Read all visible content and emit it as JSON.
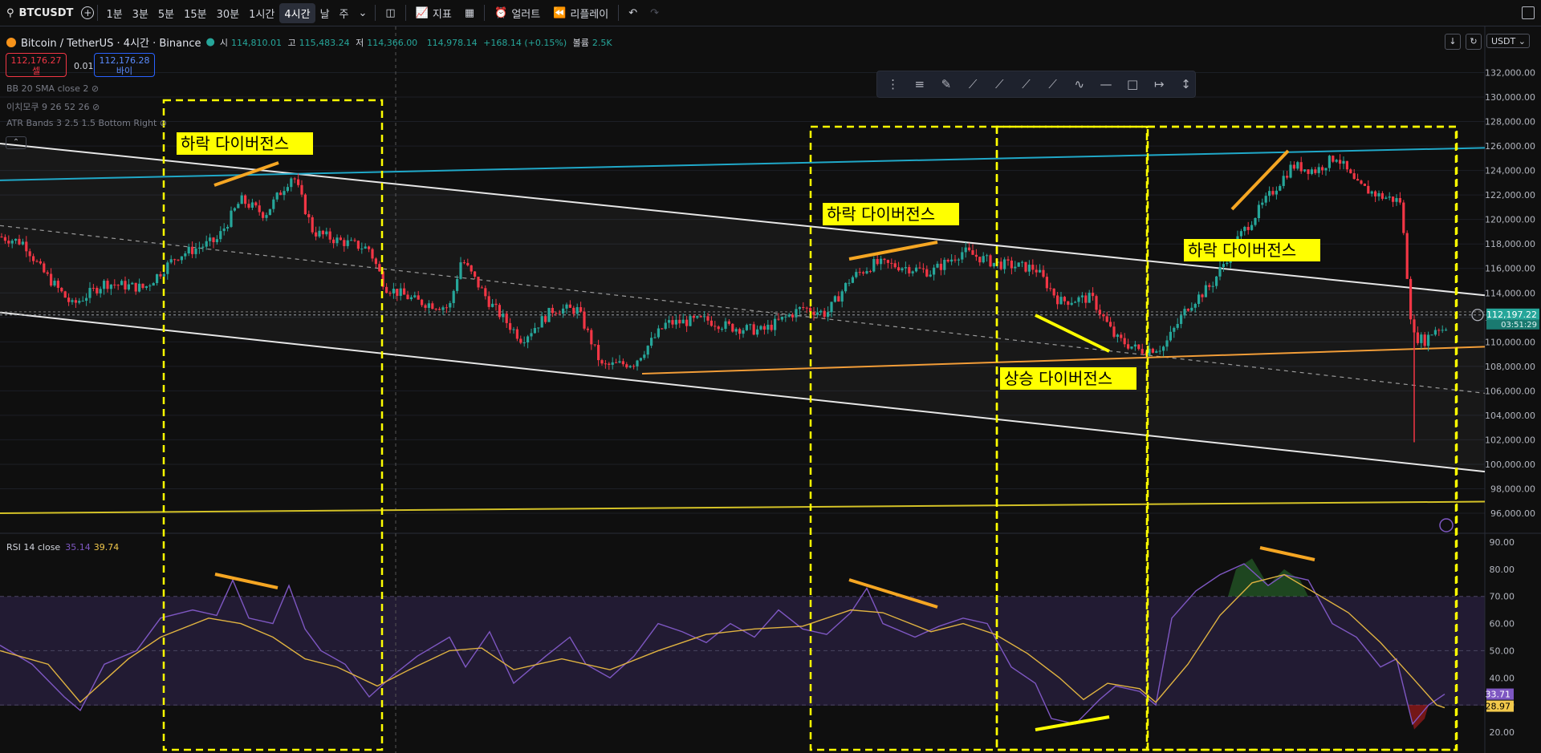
{
  "toolbar": {
    "symbol": "BTCUSDT",
    "timeframes": [
      "1분",
      "3분",
      "5분",
      "15분",
      "30분",
      "1시간",
      "4시간",
      "날",
      "주"
    ],
    "active_timeframe": "4시간",
    "indicators_label": "지표",
    "alerts_label": "얼러트",
    "replay_label": "리플레이"
  },
  "legend": {
    "title": "Bitcoin / TetherUS · 4시간 · Binance",
    "open_label": "시",
    "open": "114,810.01",
    "high_label": "고",
    "high": "115,483.24",
    "low_label": "저",
    "low": "114,366.00",
    "close_label": "",
    "close": "114,978.14",
    "change": "+168.14 (+0.15%)",
    "volume_label": "볼륨",
    "volume": "2.5K",
    "sell_price": "112,176.27",
    "sell_label": "셀",
    "spread": "0.01",
    "buy_price": "112,176.28",
    "buy_label": "바이",
    "indicators": [
      "BB 20 SMA close 2",
      "이치모쿠 9 26 52 26",
      "ATR Bands 3 2.5 1.5 Bottom Right"
    ],
    "rsi_label": "RSI 14 close",
    "rsi_value": "35.14",
    "rsi_ma_value": "39.74"
  },
  "currency": "USDT",
  "colors": {
    "up": "#26a69a",
    "down": "#f23645",
    "annotation_box": "#ffff00",
    "annotation_line": "#f5a623",
    "channel": "#e6e6e6",
    "cyan_line": "#20a8c8",
    "support": "#f29d38",
    "yellow_line": "#d4c227",
    "rsi": "#7e57c2",
    "rsi_ma": "#e0b341"
  },
  "chart_data": [
    {
      "type": "candlestick",
      "title": "Bitcoin / TetherUS · 4시간 · Binance",
      "y_ticks": [
        "132,000.00",
        "130,000.00",
        "128,000.00",
        "126,000.00",
        "124,000.00",
        "122,000.00",
        "120,000.00",
        "118,000.00",
        "116,000.00",
        "114,000.00",
        "112,000.00",
        "110,000.00",
        "108,000.00",
        "106,000.00",
        "104,000.00",
        "102,000.00",
        "100,000.00",
        "98,000.00",
        "96,000.00"
      ],
      "ylim": [
        95500,
        132800
      ],
      "last_price": "112,197.22",
      "countdown": "03:51:29",
      "path": [
        [
          0,
          118600
        ],
        [
          30,
          118100
        ],
        [
          50,
          116000
        ],
        [
          90,
          113000
        ],
        [
          130,
          114800
        ],
        [
          180,
          114400
        ],
        [
          220,
          117000
        ],
        [
          270,
          118300
        ],
        [
          300,
          121600
        ],
        [
          330,
          120400
        ],
        [
          365,
          123700
        ],
        [
          390,
          119000
        ],
        [
          420,
          118300
        ],
        [
          460,
          117600
        ],
        [
          480,
          114500
        ],
        [
          520,
          113300
        ],
        [
          560,
          112800
        ],
        [
          575,
          116800
        ],
        [
          610,
          113200
        ],
        [
          650,
          110200
        ],
        [
          690,
          112700
        ],
        [
          720,
          112600
        ],
        [
          750,
          108000
        ],
        [
          790,
          108300
        ],
        [
          830,
          111500
        ],
        [
          880,
          111800
        ],
        [
          910,
          111200
        ],
        [
          950,
          110900
        ],
        [
          1000,
          112800
        ],
        [
          1030,
          112300
        ],
        [
          1060,
          115200
        ],
        [
          1090,
          116400
        ],
        [
          1120,
          116200
        ],
        [
          1160,
          115700
        ],
        [
          1200,
          117400
        ],
        [
          1240,
          116400
        ],
        [
          1290,
          116000
        ],
        [
          1320,
          113300
        ],
        [
          1360,
          113600
        ],
        [
          1390,
          110300
        ],
        [
          1420,
          109300
        ],
        [
          1450,
          109600
        ],
        [
          1480,
          112900
        ],
        [
          1510,
          114700
        ],
        [
          1540,
          118200
        ],
        [
          1580,
          121800
        ],
        [
          1610,
          124400
        ],
        [
          1640,
          124000
        ],
        [
          1665,
          125200
        ],
        [
          1690,
          122800
        ],
        [
          1720,
          121900
        ],
        [
          1745,
          121500
        ],
        [
          1760,
          110500
        ],
        [
          1775,
          110100
        ],
        [
          1790,
          111200
        ],
        [
          1800,
          111000
        ],
        [
          1808,
          112197
        ]
      ],
      "lines": [
        {
          "name": "upper_channel",
          "from": [
            0,
            126200
          ],
          "to": [
            1850,
            113800
          ]
        },
        {
          "name": "lower_channel",
          "from": [
            0,
            112400
          ],
          "to": [
            1850,
            99400
          ]
        },
        {
          "name": "mid_channel",
          "from": [
            0,
            119500
          ],
          "to": [
            1850,
            105800
          ]
        },
        {
          "name": "cyan_line",
          "from": [
            0,
            123200
          ],
          "to": [
            1850,
            125850
          ]
        },
        {
          "name": "support_line",
          "from": [
            800,
            107400
          ],
          "to": [
            1850,
            109600
          ]
        },
        {
          "name": "yellow_line",
          "from": [
            0,
            96000
          ],
          "to": [
            1850,
            96950
          ]
        }
      ],
      "annotations": [
        "하락 다이버전스",
        "하락 다이버전스",
        "상승 다이버전스",
        "하락 다이버전스"
      ]
    },
    {
      "type": "line",
      "title": "RSI 14 close",
      "y_ticks": [
        "90.00",
        "80.00",
        "70.00",
        "60.00",
        "50.00",
        "40.00",
        "30.00",
        "20.00"
      ],
      "ylim": [
        16,
        91
      ],
      "bands": [
        30,
        50,
        70
      ],
      "rsi_value": "33.71",
      "ma_value": "28.97",
      "rsi_path": [
        [
          0,
          52
        ],
        [
          40,
          45
        ],
        [
          80,
          33
        ],
        [
          100,
          28
        ],
        [
          130,
          45
        ],
        [
          170,
          50
        ],
        [
          200,
          62
        ],
        [
          240,
          65
        ],
        [
          270,
          63
        ],
        [
          290,
          76
        ],
        [
          310,
          62
        ],
        [
          340,
          60
        ],
        [
          360,
          74
        ],
        [
          380,
          58
        ],
        [
          400,
          50
        ],
        [
          430,
          45
        ],
        [
          460,
          33
        ],
        [
          490,
          41
        ],
        [
          520,
          48
        ],
        [
          560,
          55
        ],
        [
          580,
          44
        ],
        [
          610,
          57
        ],
        [
          640,
          38
        ],
        [
          680,
          48
        ],
        [
          710,
          55
        ],
        [
          730,
          45
        ],
        [
          760,
          40
        ],
        [
          790,
          48
        ],
        [
          820,
          60
        ],
        [
          850,
          57
        ],
        [
          880,
          53
        ],
        [
          910,
          60
        ],
        [
          940,
          55
        ],
        [
          970,
          65
        ],
        [
          1000,
          58
        ],
        [
          1030,
          56
        ],
        [
          1060,
          64
        ],
        [
          1080,
          73
        ],
        [
          1100,
          60
        ],
        [
          1140,
          55
        ],
        [
          1170,
          59
        ],
        [
          1200,
          62
        ],
        [
          1230,
          60
        ],
        [
          1260,
          44
        ],
        [
          1290,
          38
        ],
        [
          1310,
          25
        ],
        [
          1340,
          23
        ],
        [
          1370,
          32
        ],
        [
          1390,
          37
        ],
        [
          1420,
          35
        ],
        [
          1440,
          30
        ],
        [
          1460,
          62
        ],
        [
          1490,
          72
        ],
        [
          1520,
          78
        ],
        [
          1550,
          82
        ],
        [
          1580,
          74
        ],
        [
          1600,
          78
        ],
        [
          1630,
          76
        ],
        [
          1660,
          60
        ],
        [
          1690,
          55
        ],
        [
          1720,
          44
        ],
        [
          1740,
          47
        ],
        [
          1760,
          23
        ],
        [
          1780,
          30
        ],
        [
          1800,
          34
        ]
      ],
      "ma_path": [
        [
          0,
          50
        ],
        [
          60,
          45
        ],
        [
          100,
          31
        ],
        [
          160,
          47
        ],
        [
          200,
          55
        ],
        [
          260,
          62
        ],
        [
          300,
          60
        ],
        [
          340,
          55
        ],
        [
          380,
          47
        ],
        [
          420,
          44
        ],
        [
          470,
          37
        ],
        [
          510,
          43
        ],
        [
          560,
          50
        ],
        [
          600,
          51
        ],
        [
          640,
          43
        ],
        [
          700,
          47
        ],
        [
          760,
          43
        ],
        [
          820,
          50
        ],
        [
          880,
          56
        ],
        [
          940,
          58
        ],
        [
          1000,
          59
        ],
        [
          1060,
          65
        ],
        [
          1100,
          64
        ],
        [
          1160,
          57
        ],
        [
          1200,
          60
        ],
        [
          1240,
          56
        ],
        [
          1280,
          49
        ],
        [
          1320,
          40
        ],
        [
          1350,
          32
        ],
        [
          1380,
          38
        ],
        [
          1420,
          36
        ],
        [
          1440,
          31
        ],
        [
          1480,
          45
        ],
        [
          1520,
          63
        ],
        [
          1560,
          75
        ],
        [
          1600,
          78
        ],
        [
          1640,
          71
        ],
        [
          1680,
          64
        ],
        [
          1720,
          53
        ],
        [
          1760,
          40
        ],
        [
          1790,
          30
        ],
        [
          1800,
          29
        ]
      ]
    }
  ]
}
